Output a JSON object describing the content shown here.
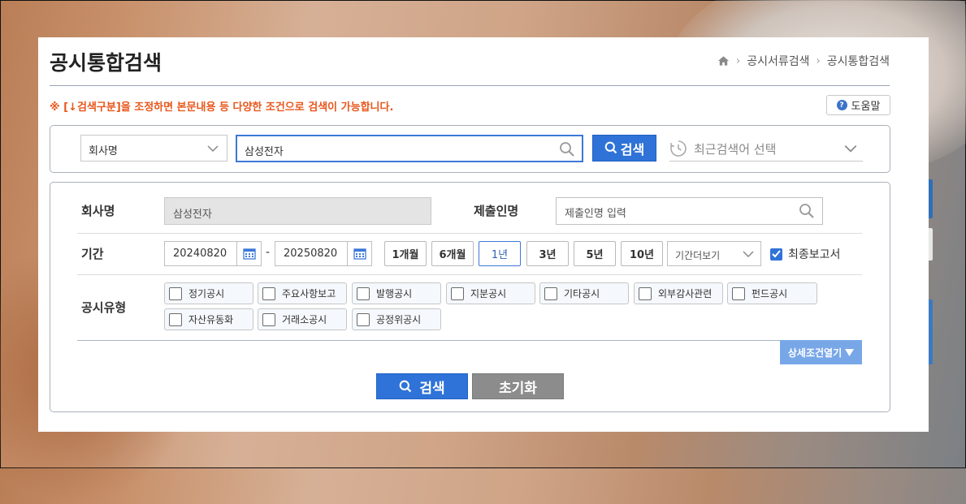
{
  "header": {
    "title": "공시통합검색",
    "breadcrumb": [
      "공시서류검색",
      "공시통합검색"
    ]
  },
  "notice": "※ [↓검색구분]을 조정하면 본문내용 등 다양한 조건으로 검색이 가능합니다.",
  "help": {
    "label": "도움말"
  },
  "search": {
    "category": "회사명",
    "query": "삼성전자",
    "button_label": "검색",
    "recent_placeholder": "최근검색어 선택"
  },
  "form": {
    "company_label": "회사명",
    "company_value": "삼성전자",
    "submitter_label": "제출인명",
    "submitter_placeholder": "제출인명 입력",
    "period_label": "기간",
    "date_from": "20240820",
    "date_to": "20250820",
    "date_separator": "-",
    "period_buttons": [
      "1개월",
      "6개월",
      "1년",
      "3년",
      "5년",
      "10년"
    ],
    "period_active": "1년",
    "period_more": "기간더보기",
    "final_report_label": "최종보고서",
    "final_report_checked": true,
    "type_label": "공시유형",
    "types": [
      "정기공시",
      "주요사항보고",
      "발행공시",
      "지분공시",
      "기타공시",
      "외부감사관련",
      "펀드공시",
      "자산유동화",
      "거래소공시",
      "공정위공시"
    ]
  },
  "actions": {
    "detail_toggle": "상세조건열기",
    "search": "검색",
    "reset": "초기화"
  },
  "colors": {
    "accent": "#2f73d8",
    "notice": "#e8571c",
    "reset": "#8c8c8c",
    "detail": "#78a7e8"
  }
}
